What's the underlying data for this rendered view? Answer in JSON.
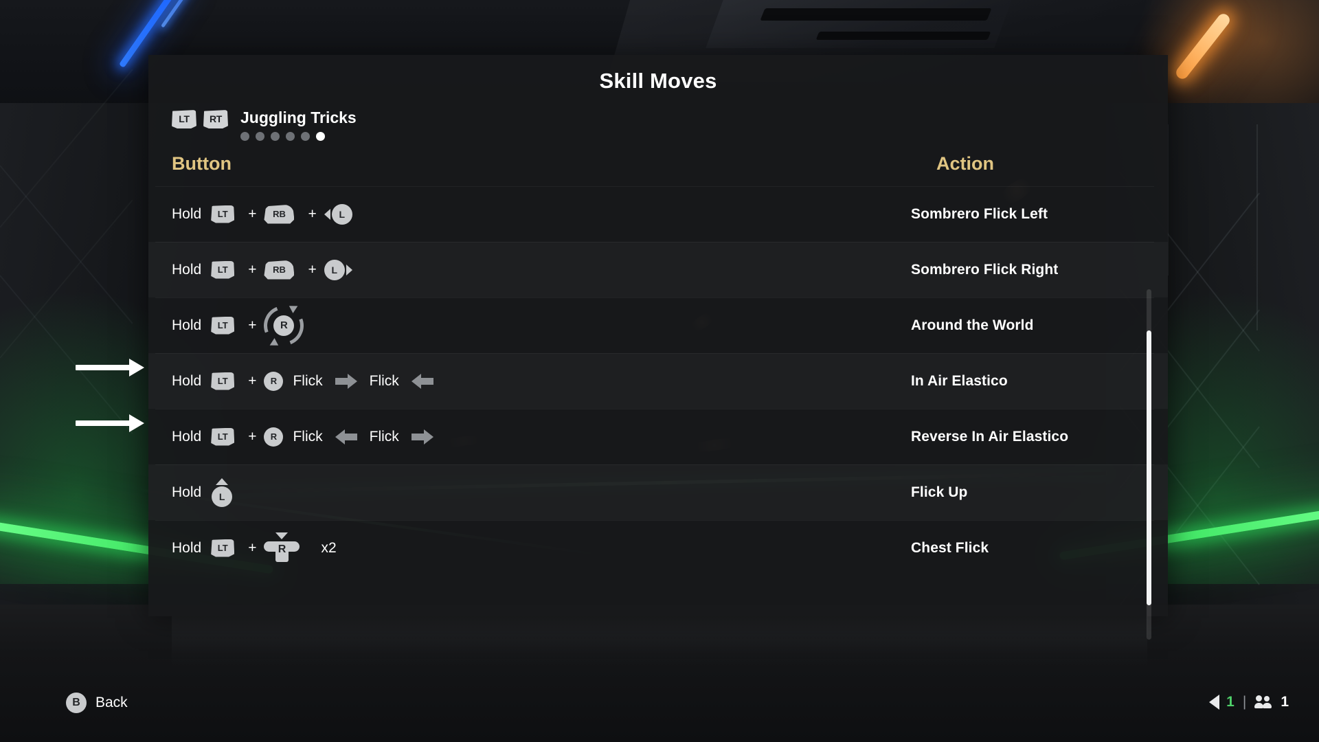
{
  "panel": {
    "title": "Skill Moves",
    "category": {
      "name": "Juggling Tricks",
      "trigger_left": "LT",
      "trigger_right": "RT",
      "page_count": 6,
      "active_page": 6
    },
    "headers": {
      "button": "Button",
      "action": "Action"
    },
    "rows": [
      {
        "action": "Sombrero Flick Left",
        "hold_label": "Hold",
        "parts": [
          {
            "kind": "word",
            "text": "Hold"
          },
          {
            "kind": "bumper",
            "text": "LT"
          },
          {
            "kind": "plus",
            "text": "+"
          },
          {
            "kind": "bumper_round",
            "text": "RB"
          },
          {
            "kind": "plus",
            "text": "+"
          },
          {
            "kind": "stick_left",
            "text": "L"
          }
        ]
      },
      {
        "action": "Sombrero Flick Right",
        "hold_label": "Hold",
        "parts": [
          {
            "kind": "word",
            "text": "Hold"
          },
          {
            "kind": "bumper",
            "text": "LT"
          },
          {
            "kind": "plus",
            "text": "+"
          },
          {
            "kind": "bumper_round",
            "text": "RB"
          },
          {
            "kind": "plus",
            "text": "+"
          },
          {
            "kind": "stick_right",
            "text": "L"
          }
        ]
      },
      {
        "action": "Around the World",
        "hold_label": "Hold",
        "parts": [
          {
            "kind": "word",
            "text": "Hold"
          },
          {
            "kind": "bumper",
            "text": "LT"
          },
          {
            "kind": "plus",
            "text": "+"
          },
          {
            "kind": "rotate_ring",
            "text": "R"
          }
        ]
      },
      {
        "action": "In Air Elastico",
        "hold_label": "Hold",
        "parts": [
          {
            "kind": "word",
            "text": "Hold"
          },
          {
            "kind": "bumper",
            "text": "LT"
          },
          {
            "kind": "plus",
            "text": "+"
          },
          {
            "kind": "stick",
            "text": "R"
          },
          {
            "kind": "word",
            "text": "Flick"
          },
          {
            "kind": "arrow_right",
            "text": ""
          },
          {
            "kind": "word",
            "text": "Flick"
          },
          {
            "kind": "arrow_left",
            "text": ""
          }
        ]
      },
      {
        "action": "Reverse In Air Elastico",
        "hold_label": "Hold",
        "parts": [
          {
            "kind": "word",
            "text": "Hold"
          },
          {
            "kind": "bumper",
            "text": "LT"
          },
          {
            "kind": "plus",
            "text": "+"
          },
          {
            "kind": "stick",
            "text": "R"
          },
          {
            "kind": "word",
            "text": "Flick"
          },
          {
            "kind": "arrow_left",
            "text": ""
          },
          {
            "kind": "word",
            "text": "Flick"
          },
          {
            "kind": "arrow_right",
            "text": ""
          }
        ]
      },
      {
        "action": "Flick Up",
        "hold_label": "Hold",
        "parts": [
          {
            "kind": "word",
            "text": "Hold"
          },
          {
            "kind": "stick_up",
            "text": "L"
          }
        ]
      },
      {
        "action": "Chest Flick",
        "hold_label": "Hold",
        "parts": [
          {
            "kind": "word",
            "text": "Hold"
          },
          {
            "kind": "bumper",
            "text": "LT"
          },
          {
            "kind": "plus",
            "text": "+"
          },
          {
            "kind": "stick_down_bar",
            "text": "R"
          },
          {
            "kind": "multiplier",
            "text": "x2"
          }
        ]
      }
    ]
  },
  "annotations": [
    {
      "name": "arrow-in-air-elastico",
      "target_row": 4
    },
    {
      "name": "arrow-reverse-in-air-elastico",
      "target_row": 5
    }
  ],
  "bottom_bar": {
    "back_button": "B",
    "back_label": "Back",
    "ping_value": "1",
    "divider": "|",
    "players_value": "1"
  },
  "colors": {
    "accent_header": "#e0c582",
    "panel_bg": "#18191b",
    "glyph": "#c9cbcd",
    "status_green": "#4fd06a"
  }
}
